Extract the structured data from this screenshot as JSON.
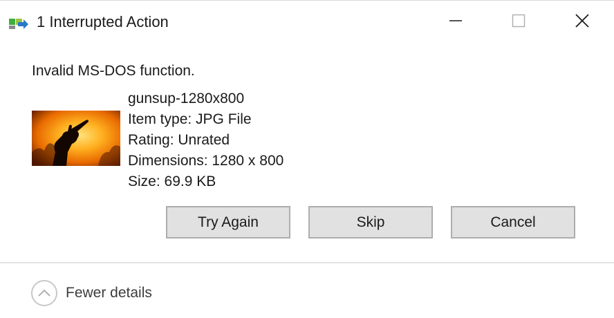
{
  "window": {
    "title": "1 Interrupted Action",
    "controls": {
      "minimize_icon": "minimize-icon",
      "maximize_icon": "maximize-icon",
      "close_icon": "close-icon"
    }
  },
  "message": "Invalid MS-DOS function.",
  "file": {
    "thumbnail_icon": "flame-hand-image",
    "name": "gunsup-1280x800",
    "item_type": "Item type: JPG File",
    "rating": "Rating: Unrated",
    "dimensions": "Dimensions: 1280 x 800",
    "size": "Size: 69.9 KB"
  },
  "buttons": {
    "try_again": "Try Again",
    "skip": "Skip",
    "cancel": "Cancel"
  },
  "footer": {
    "toggle_label": "Fewer details",
    "toggle_icon": "chevron-up-icon"
  },
  "colors": {
    "button_bg": "#e1e1e1",
    "button_border": "#adadad",
    "separator": "#e3e3e3"
  }
}
